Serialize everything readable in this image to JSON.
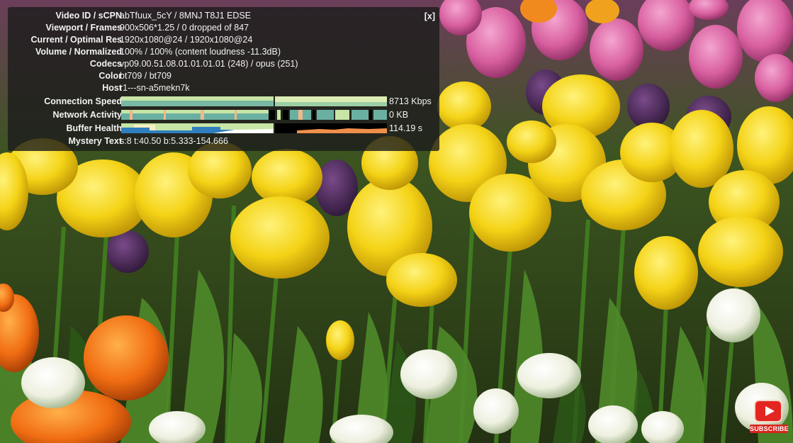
{
  "stats_panel": {
    "close_label": "[x]",
    "rows": [
      {
        "label": "Video ID / sCPN",
        "value": "abTfuux_5cY / 8MNJ T8J1 EDSE"
      },
      {
        "label": "Viewport / Frames",
        "value": "900x506*1.25 / 0 dropped of 847"
      },
      {
        "label": "Current / Optimal Res",
        "value": "1920x1080@24 / 1920x1080@24"
      },
      {
        "label": "Volume / Normalized",
        "value": "100% / 100% (content loudness -11.3dB)"
      },
      {
        "label": "Codecs",
        "value": "vp09.00.51.08.01.01.01.01 (248) / opus (251)"
      },
      {
        "label": "Color",
        "value": "bt709 / bt709"
      },
      {
        "label": "Host",
        "value": "r1---sn-a5mekn7k"
      }
    ],
    "connection_speed": {
      "label": "Connection Speed",
      "value": "8713 Kbps"
    },
    "network_activity": {
      "label": "Network Activity",
      "value": "0 KB"
    },
    "buffer_health": {
      "label": "Buffer Health",
      "value": "114.19 s"
    },
    "mystery_text": {
      "label": "Mystery Text",
      "value": "s:8 t:40.50 b:5.333-154.666"
    }
  },
  "watermark": {
    "icon": "youtube-play-icon",
    "label": "SUBSCRIBE"
  },
  "colors": {
    "panel_bg": "#1c1c1c",
    "graph_speed": "#c7e5a5",
    "graph_activity": "#6ab0a2",
    "graph_buffer_blue": "#2f7fbf",
    "graph_buffer_orange": "#ef8f4a",
    "subscribe_red": "#e3261f"
  }
}
